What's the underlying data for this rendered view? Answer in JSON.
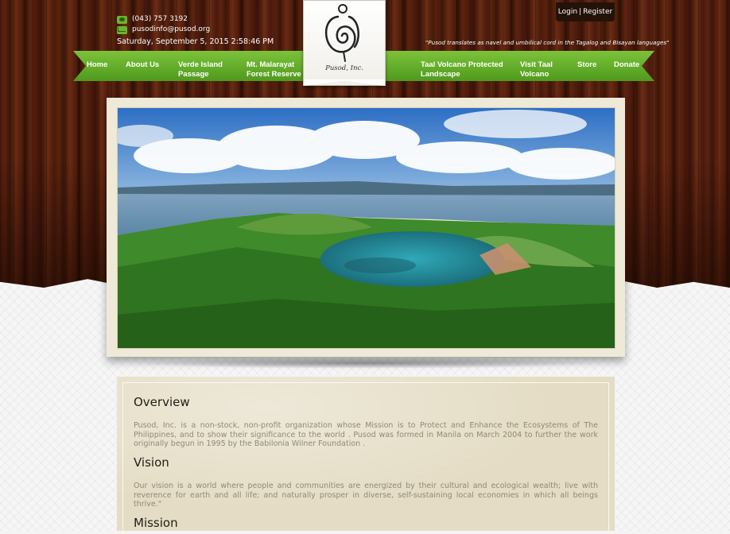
{
  "header": {
    "phone": "(043) 757 3192",
    "email": "pusodinfo@pusod.org",
    "datetime": "Saturday, September 5, 2015 2:58:46 PM",
    "login_label": "Login",
    "separator": "|",
    "register_label": "Register",
    "tagline": "\"Pusod translates as navel and umbilical cord in the Tagalog and Bisayan languages\""
  },
  "logo": {
    "text": "Pusod, Inc."
  },
  "nav": {
    "items": [
      {
        "label": "Home"
      },
      {
        "label": "About Us"
      },
      {
        "label": "Verde Island Passage"
      },
      {
        "label": "Mt. Malarayat Forest Reserve"
      },
      {
        "label": "Taal Volcano Protected Landscape"
      },
      {
        "label": "Visit Taal Volcano"
      },
      {
        "label": "Store"
      },
      {
        "label": "Donate"
      }
    ]
  },
  "content": {
    "overview_title": "Overview",
    "overview_text": "Pusod, Inc. is a non-stock, non-profit organization whose Mission is to Protect and Enhance the Ecosystems of The Philippines, and to show their significance to the world . Pusod was formed in Manila on March 2004 to further the work originally begun in 1995 by the Babilonia Wilner Foundation .",
    "vision_title": "Vision",
    "vision_text": "Our vision is a world where people and communities are energized by their cultural and ecological wealth; live with reverence for earth and all life; and naturally prosper in diverse, self-sustaining local economies in which all beings thrive.\"",
    "mission_title": "Mission"
  },
  "colors": {
    "nav_green": "#5fa828",
    "wood": "#4a1a0c",
    "panel": "#e4dcc4"
  }
}
